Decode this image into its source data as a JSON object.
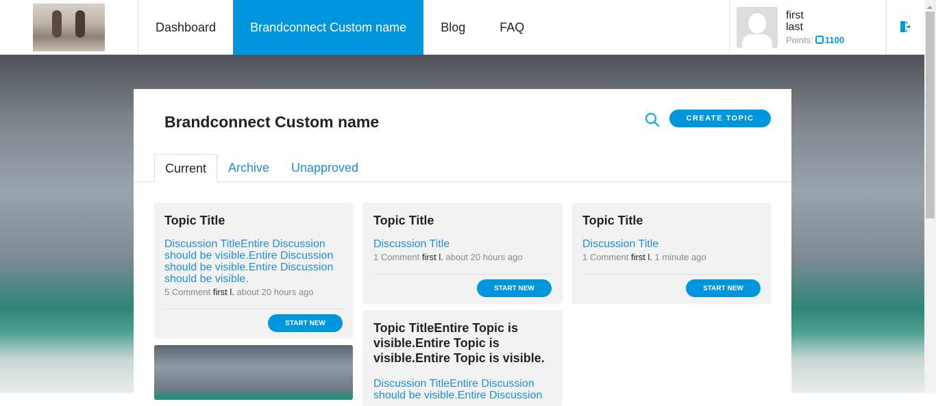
{
  "nav": {
    "items": [
      "Dashboard",
      "Brandconnect Custom name",
      "Blog",
      "FAQ"
    ],
    "active": 1
  },
  "user": {
    "first": "first",
    "last": "last",
    "points_label": "Points:",
    "points": "1100"
  },
  "panel": {
    "title": "Brandconnect Custom name",
    "create_label": "CREATE TOPIC",
    "tabs": [
      "Current",
      "Archive",
      "Unapproved"
    ]
  },
  "cards": [
    {
      "title": "Topic Title",
      "discussion": "Discussion TitleEntire Discussion should be visible.Entire Discussion should be visible.Entire Discussion should be visible.",
      "comments": "5 Comment",
      "author": "first l.",
      "time": "about 20 hours ago",
      "button": "START NEW"
    },
    {
      "title": "Topic Title",
      "discussion": "Discussion Title",
      "comments": "1 Comment",
      "author": "first l.",
      "time": "about 20 hours ago",
      "button": "START NEW"
    },
    {
      "title": "Topic Title",
      "discussion": "Discussion Title",
      "comments": "1 Comment",
      "author": "first l.",
      "time": "1 minute ago",
      "button": "START NEW"
    },
    {
      "title": "Topic TitleEntire Topic is visible.Entire Topic is visible.Entire Topic is visible.",
      "discussion": "Discussion TitleEntire Discussion should be visible.Entire Discussion"
    }
  ],
  "colors": {
    "accent": "#0096dd",
    "link": "#1e8fd6"
  }
}
